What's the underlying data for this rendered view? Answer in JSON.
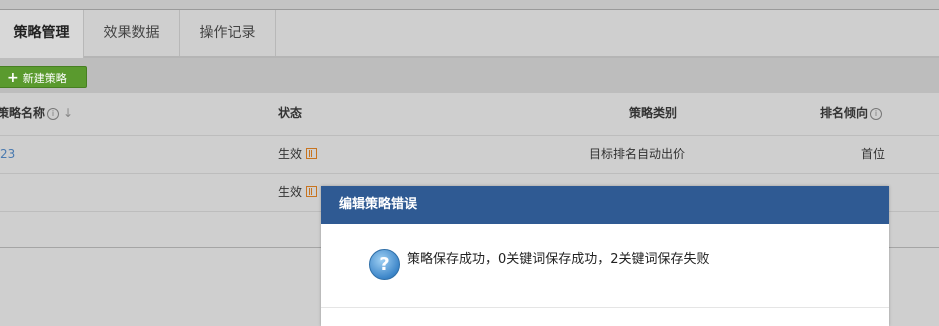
{
  "tabs": [
    {
      "label": "策略管理"
    },
    {
      "label": "效果数据"
    },
    {
      "label": "操作记录"
    }
  ],
  "toolbar": {
    "new_button": "新建策略"
  },
  "table": {
    "headers": {
      "name": "策略名称",
      "status": "状态",
      "category": "策略类别",
      "ranking": "排名倾向"
    },
    "rows": [
      {
        "name": "23",
        "status": "生效",
        "category": "目标排名自动出价",
        "ranking": "首位"
      },
      {
        "name": "",
        "status": "生效",
        "category": "",
        "ranking": ""
      }
    ]
  },
  "dialog": {
    "title": "编辑策略错误",
    "message": "策略保存成功，0关键词保存成功，2关键词保存失败"
  },
  "colors": {
    "dialog_header": "#2f5a93",
    "new_button": "#5a9a2e",
    "link": "#4a7ab0"
  }
}
